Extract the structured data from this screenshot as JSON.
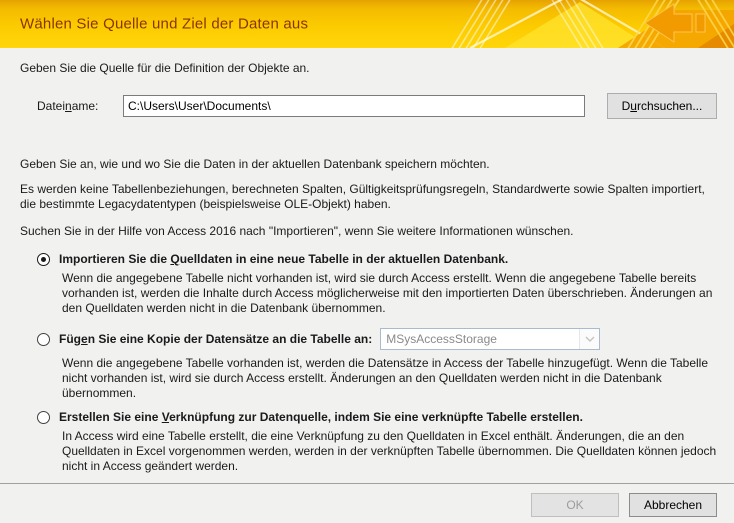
{
  "header": {
    "title": "Wählen Sie Quelle und Ziel der Daten aus"
  },
  "source_section": {
    "instruction": "Geben Sie die Quelle für die Definition der Objekte an.",
    "filename_label": {
      "pre": "Datei",
      "key": "n",
      "post": "ame:"
    },
    "filename_value": "C:\\Users\\User\\Documents\\",
    "browse_button": {
      "pre": "D",
      "key": "u",
      "post": "rchsuchen..."
    }
  },
  "destination_section": {
    "instruction": "Geben Sie an, wie und wo Sie die Daten in der aktuellen Datenbank speichern möchten.",
    "note": "Es werden keine Tabellenbeziehungen, berechneten Spalten, Gültigkeitsprüfungsregeln, Standardwerte sowie Spalten importiert, die bestimmte Legacydatentypen (beispielsweise OLE-Objekt) haben.",
    "help": "Suchen Sie in der Hilfe von Access 2016 nach \"Importieren\", wenn Sie weitere Informationen wünschen."
  },
  "options": [
    {
      "selected": true,
      "label": {
        "pre": "Importieren Sie die ",
        "key": "Q",
        "post": "uelldaten in eine neue Tabelle in der aktuellen Datenbank."
      },
      "description": "Wenn die angegebene Tabelle nicht vorhanden ist, wird sie durch Access erstellt. Wenn die angegebene Tabelle bereits vorhanden ist, werden die Inhalte durch Access möglicherweise mit den importierten Daten überschrieben. Änderungen an den Quelldaten werden nicht in die Datenbank übernommen."
    },
    {
      "selected": false,
      "label": {
        "pre": "Füg",
        "key": "e",
        "post": "n Sie eine Kopie der Datensätze an die Tabelle an:"
      },
      "combo_value": "MSysAccessStorage",
      "description": "Wenn die angegebene Tabelle vorhanden ist, werden die Datensätze in Access der Tabelle hinzugefügt. Wenn die Tabelle nicht vorhanden ist, wird sie durch Access erstellt. Änderungen an den Quelldaten werden nicht in die Datenbank übernommen."
    },
    {
      "selected": false,
      "label": {
        "pre": "Erstellen Sie eine ",
        "key": "V",
        "post": "erknüpfung zur Datenquelle, indem Sie eine verknüpfte Tabelle erstellen."
      },
      "description": "In Access wird eine Tabelle erstellt, die eine Verknüpfung zu den Quelldaten in Excel enthält. Änderungen, die an den Quelldaten in Excel vorgenommen werden, werden in der verknüpften Tabelle übernommen. Die Quelldaten können jedoch nicht in Access geändert werden."
    }
  ],
  "footer": {
    "ok_label": "OK",
    "ok_enabled": false,
    "cancel_label": "Abbrechen"
  },
  "colors": {
    "banner_gold": "#ffd000",
    "banner_amber": "#eda700",
    "banner_orange_arrow": "#f29b00",
    "title_text": "#8a3500",
    "dialog_bg": "#f1f1f0"
  }
}
